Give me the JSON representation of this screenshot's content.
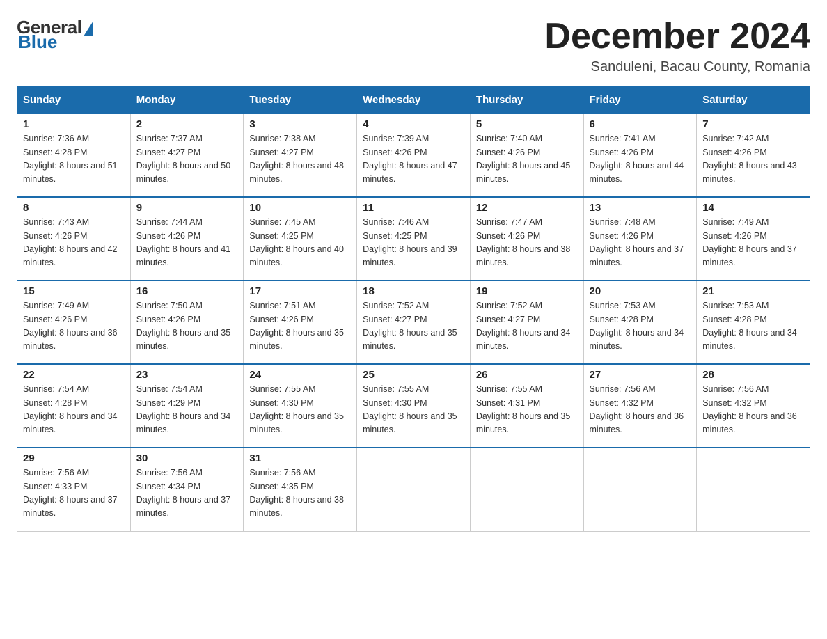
{
  "header": {
    "logo_general": "General",
    "logo_blue": "Blue",
    "month_title": "December 2024",
    "location": "Sanduleni, Bacau County, Romania"
  },
  "weekdays": [
    "Sunday",
    "Monday",
    "Tuesday",
    "Wednesday",
    "Thursday",
    "Friday",
    "Saturday"
  ],
  "weeks": [
    [
      {
        "day": "1",
        "sunrise": "7:36 AM",
        "sunset": "4:28 PM",
        "daylight": "8 hours and 51 minutes."
      },
      {
        "day": "2",
        "sunrise": "7:37 AM",
        "sunset": "4:27 PM",
        "daylight": "8 hours and 50 minutes."
      },
      {
        "day": "3",
        "sunrise": "7:38 AM",
        "sunset": "4:27 PM",
        "daylight": "8 hours and 48 minutes."
      },
      {
        "day": "4",
        "sunrise": "7:39 AM",
        "sunset": "4:26 PM",
        "daylight": "8 hours and 47 minutes."
      },
      {
        "day": "5",
        "sunrise": "7:40 AM",
        "sunset": "4:26 PM",
        "daylight": "8 hours and 45 minutes."
      },
      {
        "day": "6",
        "sunrise": "7:41 AM",
        "sunset": "4:26 PM",
        "daylight": "8 hours and 44 minutes."
      },
      {
        "day": "7",
        "sunrise": "7:42 AM",
        "sunset": "4:26 PM",
        "daylight": "8 hours and 43 minutes."
      }
    ],
    [
      {
        "day": "8",
        "sunrise": "7:43 AM",
        "sunset": "4:26 PM",
        "daylight": "8 hours and 42 minutes."
      },
      {
        "day": "9",
        "sunrise": "7:44 AM",
        "sunset": "4:26 PM",
        "daylight": "8 hours and 41 minutes."
      },
      {
        "day": "10",
        "sunrise": "7:45 AM",
        "sunset": "4:25 PM",
        "daylight": "8 hours and 40 minutes."
      },
      {
        "day": "11",
        "sunrise": "7:46 AM",
        "sunset": "4:25 PM",
        "daylight": "8 hours and 39 minutes."
      },
      {
        "day": "12",
        "sunrise": "7:47 AM",
        "sunset": "4:26 PM",
        "daylight": "8 hours and 38 minutes."
      },
      {
        "day": "13",
        "sunrise": "7:48 AM",
        "sunset": "4:26 PM",
        "daylight": "8 hours and 37 minutes."
      },
      {
        "day": "14",
        "sunrise": "7:49 AM",
        "sunset": "4:26 PM",
        "daylight": "8 hours and 37 minutes."
      }
    ],
    [
      {
        "day": "15",
        "sunrise": "7:49 AM",
        "sunset": "4:26 PM",
        "daylight": "8 hours and 36 minutes."
      },
      {
        "day": "16",
        "sunrise": "7:50 AM",
        "sunset": "4:26 PM",
        "daylight": "8 hours and 35 minutes."
      },
      {
        "day": "17",
        "sunrise": "7:51 AM",
        "sunset": "4:26 PM",
        "daylight": "8 hours and 35 minutes."
      },
      {
        "day": "18",
        "sunrise": "7:52 AM",
        "sunset": "4:27 PM",
        "daylight": "8 hours and 35 minutes."
      },
      {
        "day": "19",
        "sunrise": "7:52 AM",
        "sunset": "4:27 PM",
        "daylight": "8 hours and 34 minutes."
      },
      {
        "day": "20",
        "sunrise": "7:53 AM",
        "sunset": "4:28 PM",
        "daylight": "8 hours and 34 minutes."
      },
      {
        "day": "21",
        "sunrise": "7:53 AM",
        "sunset": "4:28 PM",
        "daylight": "8 hours and 34 minutes."
      }
    ],
    [
      {
        "day": "22",
        "sunrise": "7:54 AM",
        "sunset": "4:28 PM",
        "daylight": "8 hours and 34 minutes."
      },
      {
        "day": "23",
        "sunrise": "7:54 AM",
        "sunset": "4:29 PM",
        "daylight": "8 hours and 34 minutes."
      },
      {
        "day": "24",
        "sunrise": "7:55 AM",
        "sunset": "4:30 PM",
        "daylight": "8 hours and 35 minutes."
      },
      {
        "day": "25",
        "sunrise": "7:55 AM",
        "sunset": "4:30 PM",
        "daylight": "8 hours and 35 minutes."
      },
      {
        "day": "26",
        "sunrise": "7:55 AM",
        "sunset": "4:31 PM",
        "daylight": "8 hours and 35 minutes."
      },
      {
        "day": "27",
        "sunrise": "7:56 AM",
        "sunset": "4:32 PM",
        "daylight": "8 hours and 36 minutes."
      },
      {
        "day": "28",
        "sunrise": "7:56 AM",
        "sunset": "4:32 PM",
        "daylight": "8 hours and 36 minutes."
      }
    ],
    [
      {
        "day": "29",
        "sunrise": "7:56 AM",
        "sunset": "4:33 PM",
        "daylight": "8 hours and 37 minutes."
      },
      {
        "day": "30",
        "sunrise": "7:56 AM",
        "sunset": "4:34 PM",
        "daylight": "8 hours and 37 minutes."
      },
      {
        "day": "31",
        "sunrise": "7:56 AM",
        "sunset": "4:35 PM",
        "daylight": "8 hours and 38 minutes."
      },
      null,
      null,
      null,
      null
    ]
  ]
}
